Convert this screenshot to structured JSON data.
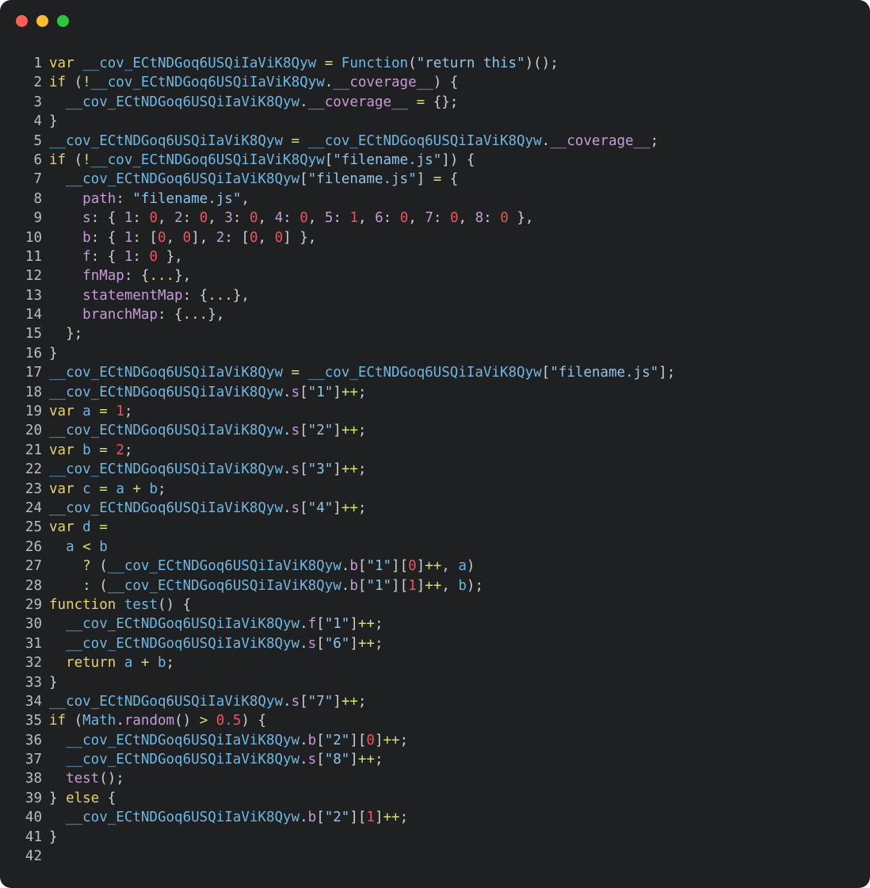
{
  "window": {
    "buttons": [
      {
        "name": "close",
        "color": "#fe5f57"
      },
      {
        "name": "minimize",
        "color": "#febc2e"
      },
      {
        "name": "maximize",
        "color": "#28c840"
      }
    ]
  },
  "code": {
    "lines": [
      [
        [
          "kw",
          "var "
        ],
        [
          "var",
          "__cov_ECtNDGoq6USQiIaViK8Qyw"
        ],
        [
          "op",
          " = "
        ],
        [
          "fn",
          "Function"
        ],
        [
          "p",
          "("
        ],
        [
          "str",
          "\"return this\""
        ],
        [
          "p",
          ")();"
        ]
      ],
      [
        [
          "kw",
          "if "
        ],
        [
          "p",
          "("
        ],
        [
          "op",
          "!"
        ],
        [
          "var",
          "__cov_ECtNDGoq6USQiIaViK8Qyw"
        ],
        [
          "p",
          "."
        ],
        [
          "prop",
          "__coverage__"
        ],
        [
          "p",
          ") {"
        ]
      ],
      [
        [
          "p",
          "  "
        ],
        [
          "var",
          "__cov_ECtNDGoq6USQiIaViK8Qyw"
        ],
        [
          "p",
          "."
        ],
        [
          "prop",
          "__coverage__"
        ],
        [
          "op",
          " = "
        ],
        [
          "p",
          "{};"
        ]
      ],
      [
        [
          "p",
          "}"
        ]
      ],
      [
        [
          "var",
          "__cov_ECtNDGoq6USQiIaViK8Qyw"
        ],
        [
          "op",
          " = "
        ],
        [
          "var",
          "__cov_ECtNDGoq6USQiIaViK8Qyw"
        ],
        [
          "p",
          "."
        ],
        [
          "prop",
          "__coverage__"
        ],
        [
          "p",
          ";"
        ]
      ],
      [
        [
          "kw",
          "if "
        ],
        [
          "p",
          "("
        ],
        [
          "op",
          "!"
        ],
        [
          "var",
          "__cov_ECtNDGoq6USQiIaViK8Qyw"
        ],
        [
          "p",
          "["
        ],
        [
          "str",
          "\"filename.js\""
        ],
        [
          "p",
          "]) {"
        ]
      ],
      [
        [
          "p",
          "  "
        ],
        [
          "var",
          "__cov_ECtNDGoq6USQiIaViK8Qyw"
        ],
        [
          "p",
          "["
        ],
        [
          "str",
          "\"filename.js\""
        ],
        [
          "p",
          "]"
        ],
        [
          "op",
          " = "
        ],
        [
          "p",
          "{"
        ]
      ],
      [
        [
          "p",
          "    "
        ],
        [
          "prop",
          "path"
        ],
        [
          "p",
          ": "
        ],
        [
          "str",
          "\"filename.js\""
        ],
        [
          "p",
          ","
        ]
      ],
      [
        [
          "p",
          "    "
        ],
        [
          "prop",
          "s"
        ],
        [
          "p",
          ": { "
        ],
        [
          "prop",
          "1"
        ],
        [
          "p",
          ": "
        ],
        [
          "num",
          "0"
        ],
        [
          "p",
          ", "
        ],
        [
          "prop",
          "2"
        ],
        [
          "p",
          ": "
        ],
        [
          "num",
          "0"
        ],
        [
          "p",
          ", "
        ],
        [
          "prop",
          "3"
        ],
        [
          "p",
          ": "
        ],
        [
          "num",
          "0"
        ],
        [
          "p",
          ", "
        ],
        [
          "prop",
          "4"
        ],
        [
          "p",
          ": "
        ],
        [
          "num",
          "0"
        ],
        [
          "p",
          ", "
        ],
        [
          "prop",
          "5"
        ],
        [
          "p",
          ": "
        ],
        [
          "num",
          "1"
        ],
        [
          "p",
          ", "
        ],
        [
          "prop",
          "6"
        ],
        [
          "p",
          ": "
        ],
        [
          "num",
          "0"
        ],
        [
          "p",
          ", "
        ],
        [
          "prop",
          "7"
        ],
        [
          "p",
          ": "
        ],
        [
          "num",
          "0"
        ],
        [
          "p",
          ", "
        ],
        [
          "prop",
          "8"
        ],
        [
          "p",
          ": "
        ],
        [
          "num",
          "0"
        ],
        [
          "p",
          " },"
        ]
      ],
      [
        [
          "p",
          "    "
        ],
        [
          "prop",
          "b"
        ],
        [
          "p",
          ": { "
        ],
        [
          "prop",
          "1"
        ],
        [
          "p",
          ": ["
        ],
        [
          "num",
          "0"
        ],
        [
          "p",
          ", "
        ],
        [
          "num",
          "0"
        ],
        [
          "p",
          "], "
        ],
        [
          "prop",
          "2"
        ],
        [
          "p",
          ": ["
        ],
        [
          "num",
          "0"
        ],
        [
          "p",
          ", "
        ],
        [
          "num",
          "0"
        ],
        [
          "p",
          "] },"
        ]
      ],
      [
        [
          "p",
          "    "
        ],
        [
          "prop",
          "f"
        ],
        [
          "p",
          ": { "
        ],
        [
          "prop",
          "1"
        ],
        [
          "p",
          ": "
        ],
        [
          "num",
          "0"
        ],
        [
          "p",
          " },"
        ]
      ],
      [
        [
          "p",
          "    "
        ],
        [
          "prop",
          "fnMap"
        ],
        [
          "p",
          ": {"
        ],
        [
          "op",
          "..."
        ],
        [
          "p",
          "},"
        ]
      ],
      [
        [
          "p",
          "    "
        ],
        [
          "prop",
          "statementMap"
        ],
        [
          "p",
          ": {"
        ],
        [
          "op",
          "..."
        ],
        [
          "p",
          "},"
        ]
      ],
      [
        [
          "p",
          "    "
        ],
        [
          "prop",
          "branchMap"
        ],
        [
          "p",
          ": {"
        ],
        [
          "op",
          "..."
        ],
        [
          "p",
          "},"
        ]
      ],
      [
        [
          "p",
          "  };"
        ]
      ],
      [
        [
          "p",
          "}"
        ]
      ],
      [
        [
          "var",
          "__cov_ECtNDGoq6USQiIaViK8Qyw"
        ],
        [
          "op",
          " = "
        ],
        [
          "var",
          "__cov_ECtNDGoq6USQiIaViK8Qyw"
        ],
        [
          "p",
          "["
        ],
        [
          "str",
          "\"filename.js\""
        ],
        [
          "p",
          "];"
        ]
      ],
      [
        [
          "var",
          "__cov_ECtNDGoq6USQiIaViK8Qyw"
        ],
        [
          "p",
          "."
        ],
        [
          "prop",
          "s"
        ],
        [
          "p",
          "["
        ],
        [
          "str",
          "\"1\""
        ],
        [
          "p",
          "]"
        ],
        [
          "op",
          "++"
        ],
        [
          "p",
          ";"
        ]
      ],
      [
        [
          "kw",
          "var "
        ],
        [
          "var",
          "a"
        ],
        [
          "op",
          " = "
        ],
        [
          "num",
          "1"
        ],
        [
          "p",
          ";"
        ]
      ],
      [
        [
          "var",
          "__cov_ECtNDGoq6USQiIaViK8Qyw"
        ],
        [
          "p",
          "."
        ],
        [
          "prop",
          "s"
        ],
        [
          "p",
          "["
        ],
        [
          "str",
          "\"2\""
        ],
        [
          "p",
          "]"
        ],
        [
          "op",
          "++"
        ],
        [
          "p",
          ";"
        ]
      ],
      [
        [
          "kw",
          "var "
        ],
        [
          "var",
          "b"
        ],
        [
          "op",
          " = "
        ],
        [
          "num",
          "2"
        ],
        [
          "p",
          ";"
        ]
      ],
      [
        [
          "var",
          "__cov_ECtNDGoq6USQiIaViK8Qyw"
        ],
        [
          "p",
          "."
        ],
        [
          "prop",
          "s"
        ],
        [
          "p",
          "["
        ],
        [
          "str",
          "\"3\""
        ],
        [
          "p",
          "]"
        ],
        [
          "op",
          "++"
        ],
        [
          "p",
          ";"
        ]
      ],
      [
        [
          "kw",
          "var "
        ],
        [
          "var",
          "c"
        ],
        [
          "op",
          " = "
        ],
        [
          "var",
          "a"
        ],
        [
          "op",
          " + "
        ],
        [
          "var",
          "b"
        ],
        [
          "p",
          ";"
        ]
      ],
      [
        [
          "var",
          "__cov_ECtNDGoq6USQiIaViK8Qyw"
        ],
        [
          "p",
          "."
        ],
        [
          "prop",
          "s"
        ],
        [
          "p",
          "["
        ],
        [
          "str",
          "\"4\""
        ],
        [
          "p",
          "]"
        ],
        [
          "op",
          "++"
        ],
        [
          "p",
          ";"
        ]
      ],
      [
        [
          "kw",
          "var "
        ],
        [
          "var",
          "d"
        ],
        [
          "op",
          " ="
        ]
      ],
      [
        [
          "p",
          "  "
        ],
        [
          "var",
          "a"
        ],
        [
          "op",
          " < "
        ],
        [
          "var",
          "b"
        ]
      ],
      [
        [
          "p",
          "    "
        ],
        [
          "op",
          "? "
        ],
        [
          "p",
          "("
        ],
        [
          "var",
          "__cov_ECtNDGoq6USQiIaViK8Qyw"
        ],
        [
          "p",
          "."
        ],
        [
          "prop",
          "b"
        ],
        [
          "p",
          "["
        ],
        [
          "str",
          "\"1\""
        ],
        [
          "p",
          "]["
        ],
        [
          "num",
          "0"
        ],
        [
          "p",
          "]"
        ],
        [
          "op",
          "++"
        ],
        [
          "p",
          ", "
        ],
        [
          "var",
          "a"
        ],
        [
          "p",
          ")"
        ]
      ],
      [
        [
          "p",
          "    "
        ],
        [
          "op",
          ": "
        ],
        [
          "p",
          "("
        ],
        [
          "var",
          "__cov_ECtNDGoq6USQiIaViK8Qyw"
        ],
        [
          "p",
          "."
        ],
        [
          "prop",
          "b"
        ],
        [
          "p",
          "["
        ],
        [
          "str",
          "\"1\""
        ],
        [
          "p",
          "]["
        ],
        [
          "num",
          "1"
        ],
        [
          "p",
          "]"
        ],
        [
          "op",
          "++"
        ],
        [
          "p",
          ", "
        ],
        [
          "var",
          "b"
        ],
        [
          "p",
          ");"
        ]
      ],
      [
        [
          "kw",
          "function "
        ],
        [
          "fn",
          "test"
        ],
        [
          "p",
          "() {"
        ]
      ],
      [
        [
          "p",
          "  "
        ],
        [
          "var",
          "__cov_ECtNDGoq6USQiIaViK8Qyw"
        ],
        [
          "p",
          "."
        ],
        [
          "prop",
          "f"
        ],
        [
          "p",
          "["
        ],
        [
          "str",
          "\"1\""
        ],
        [
          "p",
          "]"
        ],
        [
          "op",
          "++"
        ],
        [
          "p",
          ";"
        ]
      ],
      [
        [
          "p",
          "  "
        ],
        [
          "var",
          "__cov_ECtNDGoq6USQiIaViK8Qyw"
        ],
        [
          "p",
          "."
        ],
        [
          "prop",
          "s"
        ],
        [
          "p",
          "["
        ],
        [
          "str",
          "\"6\""
        ],
        [
          "p",
          "]"
        ],
        [
          "op",
          "++"
        ],
        [
          "p",
          ";"
        ]
      ],
      [
        [
          "p",
          "  "
        ],
        [
          "kw",
          "return "
        ],
        [
          "var",
          "a"
        ],
        [
          "op",
          " + "
        ],
        [
          "var",
          "b"
        ],
        [
          "p",
          ";"
        ]
      ],
      [
        [
          "p",
          "}"
        ]
      ],
      [
        [
          "var",
          "__cov_ECtNDGoq6USQiIaViK8Qyw"
        ],
        [
          "p",
          "."
        ],
        [
          "prop",
          "s"
        ],
        [
          "p",
          "["
        ],
        [
          "str",
          "\"7\""
        ],
        [
          "p",
          "]"
        ],
        [
          "op",
          "++"
        ],
        [
          "p",
          ";"
        ]
      ],
      [
        [
          "kw",
          "if "
        ],
        [
          "p",
          "("
        ],
        [
          "var",
          "Math"
        ],
        [
          "p",
          "."
        ],
        [
          "prop",
          "random"
        ],
        [
          "p",
          "()"
        ],
        [
          "op",
          " > "
        ],
        [
          "num",
          "0.5"
        ],
        [
          "p",
          ") {"
        ]
      ],
      [
        [
          "p",
          "  "
        ],
        [
          "var",
          "__cov_ECtNDGoq6USQiIaViK8Qyw"
        ],
        [
          "p",
          "."
        ],
        [
          "prop",
          "b"
        ],
        [
          "p",
          "["
        ],
        [
          "str",
          "\"2\""
        ],
        [
          "p",
          "]["
        ],
        [
          "num",
          "0"
        ],
        [
          "p",
          "]"
        ],
        [
          "op",
          "++"
        ],
        [
          "p",
          ";"
        ]
      ],
      [
        [
          "p",
          "  "
        ],
        [
          "var",
          "__cov_ECtNDGoq6USQiIaViK8Qyw"
        ],
        [
          "p",
          "."
        ],
        [
          "prop",
          "s"
        ],
        [
          "p",
          "["
        ],
        [
          "str",
          "\"8\""
        ],
        [
          "p",
          "]"
        ],
        [
          "op",
          "++"
        ],
        [
          "p",
          ";"
        ]
      ],
      [
        [
          "p",
          "  "
        ],
        [
          "prop",
          "test"
        ],
        [
          "p",
          "();"
        ]
      ],
      [
        [
          "p",
          "} "
        ],
        [
          "kw",
          "else "
        ],
        [
          "p",
          "{"
        ]
      ],
      [
        [
          "p",
          "  "
        ],
        [
          "var",
          "__cov_ECtNDGoq6USQiIaViK8Qyw"
        ],
        [
          "p",
          "."
        ],
        [
          "prop",
          "b"
        ],
        [
          "p",
          "["
        ],
        [
          "str",
          "\"2\""
        ],
        [
          "p",
          "]["
        ],
        [
          "num",
          "1"
        ],
        [
          "p",
          "]"
        ],
        [
          "op",
          "++"
        ],
        [
          "p",
          ";"
        ]
      ],
      [
        [
          "p",
          "}"
        ]
      ],
      []
    ]
  }
}
